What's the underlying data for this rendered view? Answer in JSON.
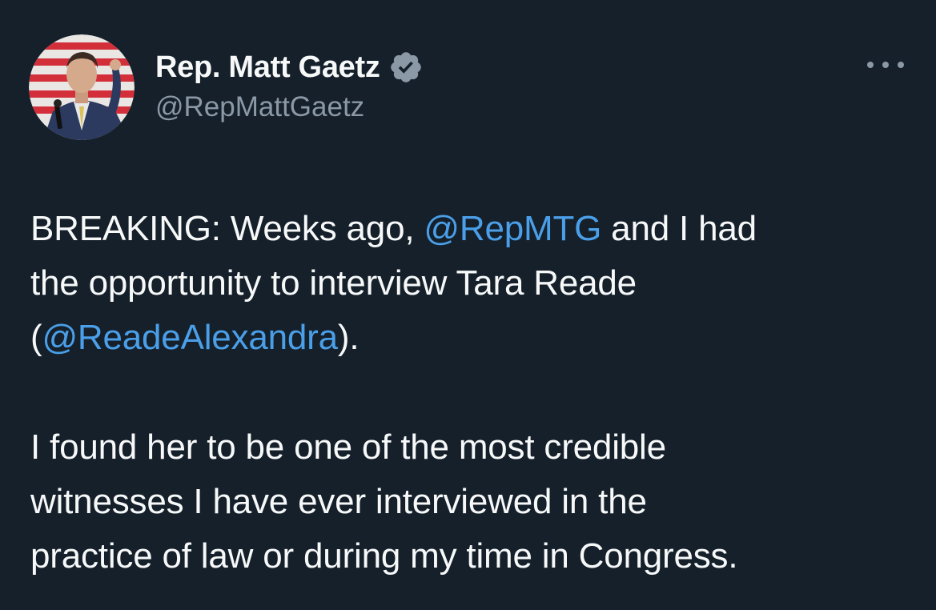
{
  "author": {
    "display_name": "Rep. Matt Gaetz",
    "handle": "@RepMattGaetz",
    "verified_icon": "verified-badge-icon",
    "avatar_icon": "avatar"
  },
  "menu": {
    "more_icon": "more-options-icon"
  },
  "tweet": {
    "line1_a": "BREAKING: Weeks ago, ",
    "mention1": "@RepMTG",
    "line1_b": " and I had",
    "line2": "the opportunity to interview Tara Reade",
    "line3_open": "(",
    "mention2": "@ReadeAlexandra",
    "line3_close": ").",
    "para2_line1": "I found her to be one of the most credible",
    "para2_line2": "witnesses I have ever interviewed in the",
    "para2_line3": "practice of law or during my time in Congress."
  },
  "colors": {
    "background": "#15202b",
    "text": "#f7f9f9",
    "secondary": "#8b98a5",
    "link": "#4a9fe8"
  }
}
